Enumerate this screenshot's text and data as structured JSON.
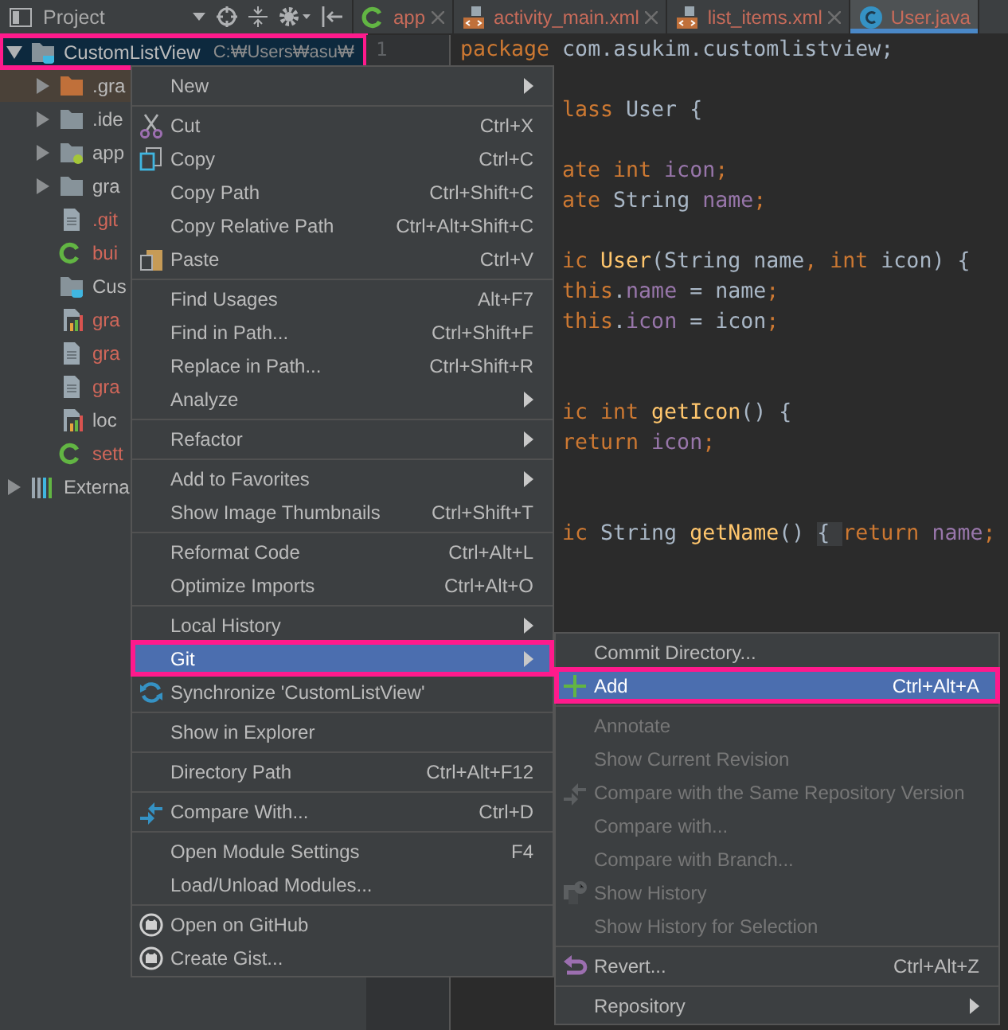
{
  "toolbar": {
    "title": "Project"
  },
  "tabs": [
    {
      "label": "app",
      "kind": "gradle",
      "selected": false
    },
    {
      "label": "activity_main.xml",
      "kind": "xml",
      "selected": false
    },
    {
      "label": "list_items.xml",
      "kind": "xml",
      "selected": false
    },
    {
      "label": "User.java",
      "kind": "class",
      "selected": true
    }
  ],
  "tree": [
    {
      "name": "CustomListView",
      "path": "C:₩Users₩asu₩",
      "kind": "module",
      "expanded": true,
      "selected": true,
      "annotated": true,
      "untracked": false,
      "children": [
        {
          "name": ".gra",
          "kind": "excluded-folder",
          "expanded": false,
          "selected": false,
          "untracked": false
        },
        {
          "name": ".ide",
          "kind": "folder",
          "expanded": false,
          "selected": false,
          "untracked": false
        },
        {
          "name": "app",
          "kind": "module-folder",
          "expanded": false,
          "selected": false,
          "untracked": false
        },
        {
          "name": "gra",
          "kind": "folder",
          "expanded": false,
          "selected": false,
          "untracked": false
        },
        {
          "name": ".git",
          "kind": "file",
          "selected": false,
          "untracked": true
        },
        {
          "name": "bui",
          "kind": "gradle",
          "selected": false,
          "untracked": true
        },
        {
          "name": "Cus",
          "kind": "module",
          "selected": false,
          "untracked": false
        },
        {
          "name": "gra",
          "kind": "chart",
          "selected": false,
          "untracked": true
        },
        {
          "name": "gra",
          "kind": "file",
          "selected": false,
          "untracked": true
        },
        {
          "name": "gra",
          "kind": "file",
          "selected": false,
          "untracked": true
        },
        {
          "name": "loc",
          "kind": "chart",
          "selected": false,
          "untracked": false
        },
        {
          "name": "sett",
          "kind": "gradle",
          "selected": false,
          "untracked": true
        }
      ]
    },
    {
      "name": "Externa",
      "kind": "libraries",
      "expanded": false,
      "selected": false,
      "annotated": false,
      "untracked": false
    }
  ],
  "gutter": {
    "line_numbers": [
      "1"
    ]
  },
  "code": [
    {
      "kind": "code",
      "covered": false,
      "tokens": [
        {
          "text": "package",
          "kind": "keyword"
        },
        {
          "text": " com.asukim.customlistview;",
          "kind": "plain"
        }
      ]
    },
    {
      "kind": "blank"
    },
    {
      "kind": "code",
      "covered": true,
      "tokens": [
        {
          "text": "lass",
          "kind": "keyword"
        },
        {
          "text": " User {",
          "kind": "plain"
        }
      ]
    },
    {
      "kind": "blank"
    },
    {
      "kind": "code",
      "covered": true,
      "tokens": [
        {
          "text": "ate int",
          "kind": "keyword"
        },
        {
          "text": " icon",
          "kind": "field"
        },
        {
          "text": ";",
          "kind": "keyword"
        }
      ]
    },
    {
      "kind": "code",
      "covered": true,
      "tokens": [
        {
          "text": "ate",
          "kind": "keyword"
        },
        {
          "text": " String ",
          "kind": "plain"
        },
        {
          "text": "name",
          "kind": "field"
        },
        {
          "text": ";",
          "kind": "keyword"
        }
      ]
    },
    {
      "kind": "blank"
    },
    {
      "kind": "code",
      "covered": true,
      "tokens": [
        {
          "text": "ic",
          "kind": "keyword"
        },
        {
          "text": " User",
          "kind": "method"
        },
        {
          "text": "(String name",
          "kind": "plain"
        },
        {
          "text": ", int ",
          "kind": "keyword"
        },
        {
          "text": "icon) {",
          "kind": "plain"
        }
      ]
    },
    {
      "kind": "code",
      "covered": true,
      "tokens": [
        {
          "text": "this",
          "kind": "keyword"
        },
        {
          "text": ".",
          "kind": "plain"
        },
        {
          "text": "name",
          "kind": "field"
        },
        {
          "text": " = name",
          "kind": "plain"
        },
        {
          "text": ";",
          "kind": "keyword"
        }
      ]
    },
    {
      "kind": "code",
      "covered": true,
      "tokens": [
        {
          "text": "this",
          "kind": "keyword"
        },
        {
          "text": ".",
          "kind": "plain"
        },
        {
          "text": "icon",
          "kind": "field"
        },
        {
          "text": " = icon",
          "kind": "plain"
        },
        {
          "text": ";",
          "kind": "keyword"
        }
      ]
    },
    {
      "kind": "blank"
    },
    {
      "kind": "blank"
    },
    {
      "kind": "code",
      "covered": true,
      "tokens": [
        {
          "text": "ic int ",
          "kind": "keyword"
        },
        {
          "text": "getIcon",
          "kind": "method"
        },
        {
          "text": "() {",
          "kind": "plain"
        }
      ]
    },
    {
      "kind": "code",
      "covered": true,
      "tokens": [
        {
          "text": "return ",
          "kind": "keyword"
        },
        {
          "text": "icon",
          "kind": "field"
        },
        {
          "text": ";",
          "kind": "keyword"
        }
      ]
    },
    {
      "kind": "blank"
    },
    {
      "kind": "blank"
    },
    {
      "kind": "code",
      "covered": true,
      "tokens": [
        {
          "text": "ic",
          "kind": "keyword"
        },
        {
          "text": " String ",
          "kind": "plain"
        },
        {
          "text": "getName",
          "kind": "method"
        },
        {
          "text": "() ",
          "kind": "plain"
        },
        {
          "text": "{ ",
          "kind": "fold"
        },
        {
          "text": "return ",
          "kind": "keyword"
        },
        {
          "text": "name",
          "kind": "field"
        },
        {
          "text": ";",
          "kind": "keyword"
        }
      ]
    }
  ],
  "context_menu": [
    {
      "label": "New",
      "kind": "plain",
      "submenu": true,
      "separated": false,
      "selected": false,
      "annotated": false
    },
    {
      "label": "Cut",
      "shortcut": "Ctrl+X",
      "kind": "scissors",
      "separated": true,
      "selected": false,
      "annotated": false
    },
    {
      "label": "Copy",
      "shortcut": "Ctrl+C",
      "kind": "copy",
      "separated": false,
      "selected": false,
      "annotated": false
    },
    {
      "label": "Copy Path",
      "shortcut": "Ctrl+Shift+C",
      "kind": "plain",
      "separated": false,
      "selected": false,
      "annotated": false
    },
    {
      "label": "Copy Relative Path",
      "shortcut": "Ctrl+Alt+Shift+C",
      "kind": "plain",
      "separated": false,
      "selected": false,
      "annotated": false
    },
    {
      "label": "Paste",
      "shortcut": "Ctrl+V",
      "kind": "paste",
      "separated": false,
      "selected": false,
      "annotated": false
    },
    {
      "label": "Find Usages",
      "shortcut": "Alt+F7",
      "kind": "plain",
      "separated": true,
      "selected": false,
      "annotated": false
    },
    {
      "label": "Find in Path...",
      "shortcut": "Ctrl+Shift+F",
      "kind": "plain",
      "separated": false,
      "selected": false,
      "annotated": false
    },
    {
      "label": "Replace in Path...",
      "shortcut": "Ctrl+Shift+R",
      "kind": "plain",
      "separated": false,
      "selected": false,
      "annotated": false
    },
    {
      "label": "Analyze",
      "kind": "plain",
      "submenu": true,
      "separated": false,
      "selected": false,
      "annotated": false
    },
    {
      "label": "Refactor",
      "kind": "plain",
      "submenu": true,
      "separated": true,
      "selected": false,
      "annotated": false
    },
    {
      "label": "Add to Favorites",
      "kind": "plain",
      "submenu": true,
      "separated": true,
      "selected": false,
      "annotated": false
    },
    {
      "label": "Show Image Thumbnails",
      "shortcut": "Ctrl+Shift+T",
      "kind": "plain",
      "separated": false,
      "selected": false,
      "annotated": false
    },
    {
      "label": "Reformat Code",
      "shortcut": "Ctrl+Alt+L",
      "kind": "plain",
      "separated": true,
      "selected": false,
      "annotated": false
    },
    {
      "label": "Optimize Imports",
      "shortcut": "Ctrl+Alt+O",
      "kind": "plain",
      "separated": false,
      "selected": false,
      "annotated": false
    },
    {
      "label": "Local History",
      "kind": "plain",
      "submenu": true,
      "separated": true,
      "selected": false,
      "annotated": false
    },
    {
      "label": "Git",
      "kind": "plain",
      "submenu": true,
      "separated": false,
      "selected": true,
      "annotated": true
    },
    {
      "label": "Synchronize 'CustomListView'",
      "kind": "sync",
      "separated": false,
      "selected": false,
      "annotated": false
    },
    {
      "label": "Show in Explorer",
      "kind": "plain",
      "separated": true,
      "selected": false,
      "annotated": false
    },
    {
      "label": "Directory Path",
      "shortcut": "Ctrl+Alt+F12",
      "kind": "plain",
      "separated": true,
      "selected": false,
      "annotated": false
    },
    {
      "label": "Compare With...",
      "shortcut": "Ctrl+D",
      "kind": "compare",
      "separated": true,
      "selected": false,
      "annotated": false
    },
    {
      "label": "Open Module Settings",
      "shortcut": "F4",
      "kind": "plain",
      "separated": true,
      "selected": false,
      "annotated": false
    },
    {
      "label": "Load/Unload Modules...",
      "kind": "plain",
      "separated": false,
      "selected": false,
      "annotated": false
    },
    {
      "label": "Open on GitHub",
      "kind": "cat",
      "separated": true,
      "selected": false,
      "annotated": false
    },
    {
      "label": "Create Gist...",
      "kind": "cat",
      "separated": false,
      "selected": false,
      "annotated": false
    }
  ],
  "git_submenu": [
    {
      "label": "Commit Directory...",
      "kind": "plain",
      "separated": false,
      "disabled": false,
      "selected": false,
      "annotated": false
    },
    {
      "label": "Add",
      "shortcut": "Ctrl+Alt+A",
      "kind": "plus",
      "separated": false,
      "disabled": false,
      "selected": true,
      "annotated": true
    },
    {
      "label": "Annotate",
      "kind": "plain",
      "separated": true,
      "disabled": true,
      "selected": false,
      "annotated": false
    },
    {
      "label": "Show Current Revision",
      "kind": "plain",
      "separated": false,
      "disabled": true,
      "selected": false,
      "annotated": false
    },
    {
      "label": "Compare with the Same Repository Version",
      "kind": "compare",
      "separated": false,
      "disabled": true,
      "selected": false,
      "annotated": false
    },
    {
      "label": "Compare with...",
      "kind": "plain",
      "separated": false,
      "disabled": true,
      "selected": false,
      "annotated": false
    },
    {
      "label": "Compare with Branch...",
      "kind": "plain",
      "separated": false,
      "disabled": true,
      "selected": false,
      "annotated": false
    },
    {
      "label": "Show History",
      "kind": "history",
      "separated": false,
      "disabled": true,
      "selected": false,
      "annotated": false
    },
    {
      "label": "Show History for Selection",
      "kind": "plain",
      "separated": false,
      "disabled": true,
      "selected": false,
      "annotated": false
    },
    {
      "label": "Revert...",
      "shortcut": "Ctrl+Alt+Z",
      "kind": "revert",
      "separated": true,
      "disabled": false,
      "selected": false,
      "annotated": false
    },
    {
      "label": "Repository",
      "kind": "plain",
      "submenu": true,
      "separated": true,
      "disabled": false,
      "selected": false,
      "annotated": false
    }
  ]
}
